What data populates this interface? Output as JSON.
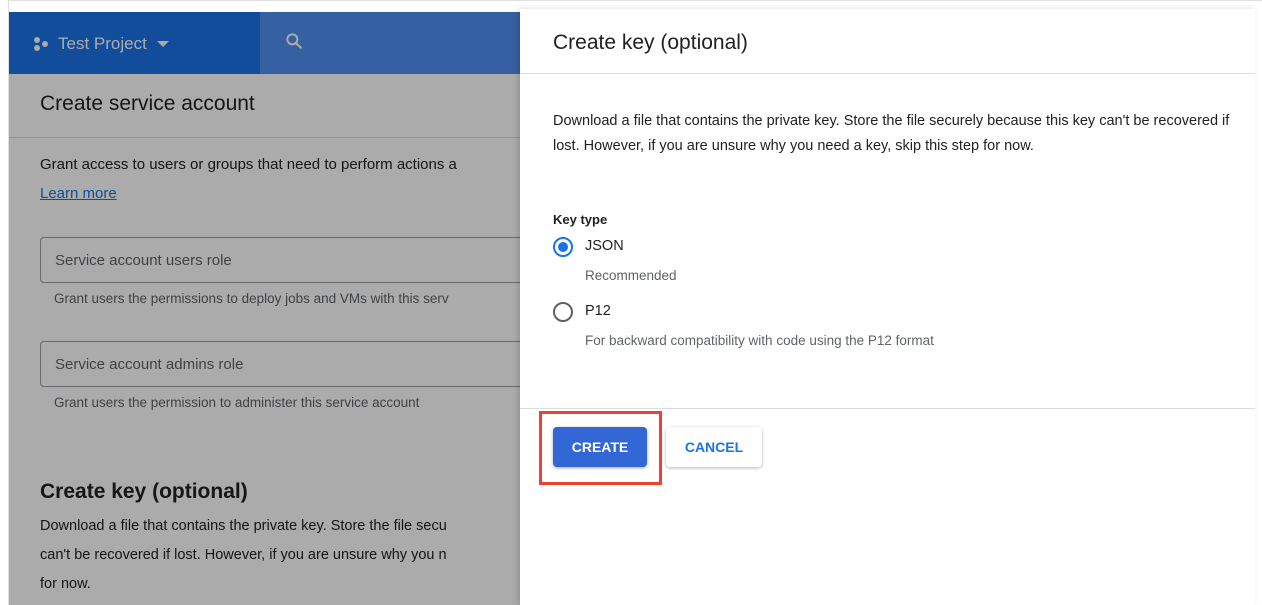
{
  "header": {
    "project_name": "Test Project",
    "icons": {
      "project": "project-dots-icon",
      "dropdown": "caret-down-icon",
      "search": "search-icon"
    }
  },
  "background_page": {
    "title": "Create service account",
    "description": "Grant access to users or groups that need to perform actions a",
    "learn_more": "Learn more",
    "fields": [
      {
        "label": "Service account users role",
        "help": "Grant users the permissions to deploy jobs and VMs with this serv"
      },
      {
        "label": "Service account admins role",
        "help": "Grant users the permission to administer this service account"
      }
    ],
    "key_section": {
      "title": "Create key (optional)",
      "lines": [
        "Download a file that contains the private key. Store the file secu",
        "can't be recovered if lost. However, if you are unsure why you n",
        "for now."
      ]
    }
  },
  "panel": {
    "title": "Create key (optional)",
    "description": "Download a file that contains the private key. Store the file securely because this key can't be recovered if lost. However, if you are unsure why you need a key, skip this step for now.",
    "key_type_label": "Key type",
    "options": [
      {
        "label": "JSON",
        "sublabel": "Recommended",
        "selected": true
      },
      {
        "label": "P12",
        "sublabel": "For backward compatibility with code using the P12 format",
        "selected": false
      }
    ],
    "create_label": "CREATE",
    "cancel_label": "CANCEL"
  },
  "colors": {
    "primary": "#1a73e8",
    "button": "#3367d6",
    "highlight": "#ea4335"
  }
}
